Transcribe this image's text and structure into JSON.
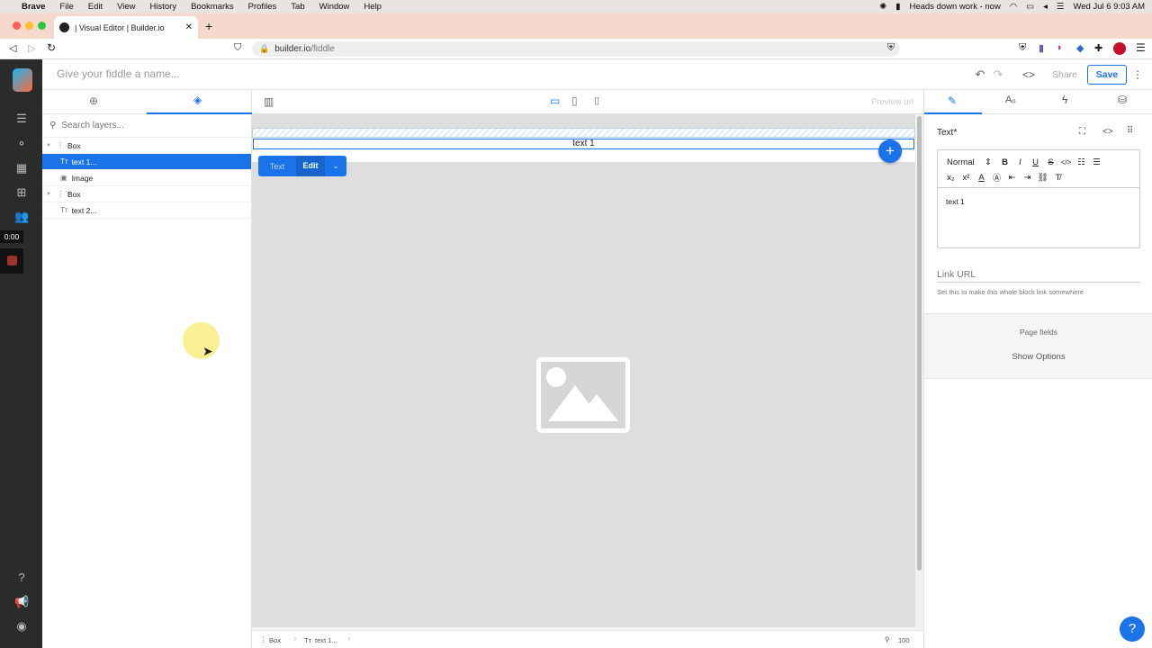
{
  "menubar": {
    "app": "Brave",
    "items": [
      "File",
      "Edit",
      "View",
      "History",
      "Bookmarks",
      "Profiles",
      "Tab",
      "Window",
      "Help"
    ],
    "status": "Heads down work - now",
    "datetime": "Wed Jul 6  9:03 AM"
  },
  "browser": {
    "tab_title": "| Visual Editor | Builder.io",
    "url_domain": "builder.io",
    "url_path": "/fiddle"
  },
  "header": {
    "name_placeholder": "Give your fiddle a name...",
    "share_label": "Share",
    "save_label": "Save"
  },
  "recording": {
    "time": "0:00"
  },
  "layers": {
    "search_placeholder": "Search layers...",
    "items": [
      {
        "label": "Box",
        "type": "box"
      },
      {
        "label": "text 1...",
        "type": "text"
      },
      {
        "label": "Image",
        "type": "image"
      },
      {
        "label": "Box",
        "type": "box"
      },
      {
        "label": "text 2...",
        "type": "text"
      }
    ]
  },
  "canvas": {
    "preview_url": "Preview url",
    "selected_text": "text 1",
    "block_type": "Text",
    "edit_label": "Edit",
    "breadcrumb": [
      "Box",
      "text 1..."
    ],
    "zoom": "100"
  },
  "right_panel": {
    "title": "Text*",
    "format_select": "Normal",
    "editor_text": "text 1",
    "link_placeholder": "Link URL",
    "link_help": "Set this to make this whole block link somewhere",
    "page_fields": "Page fields",
    "show_options": "Show Options"
  },
  "colors": {
    "accent": "#1a73e8",
    "tab_strip": "#f6d9cd",
    "sidebar_dark": "#2b2b2b"
  }
}
